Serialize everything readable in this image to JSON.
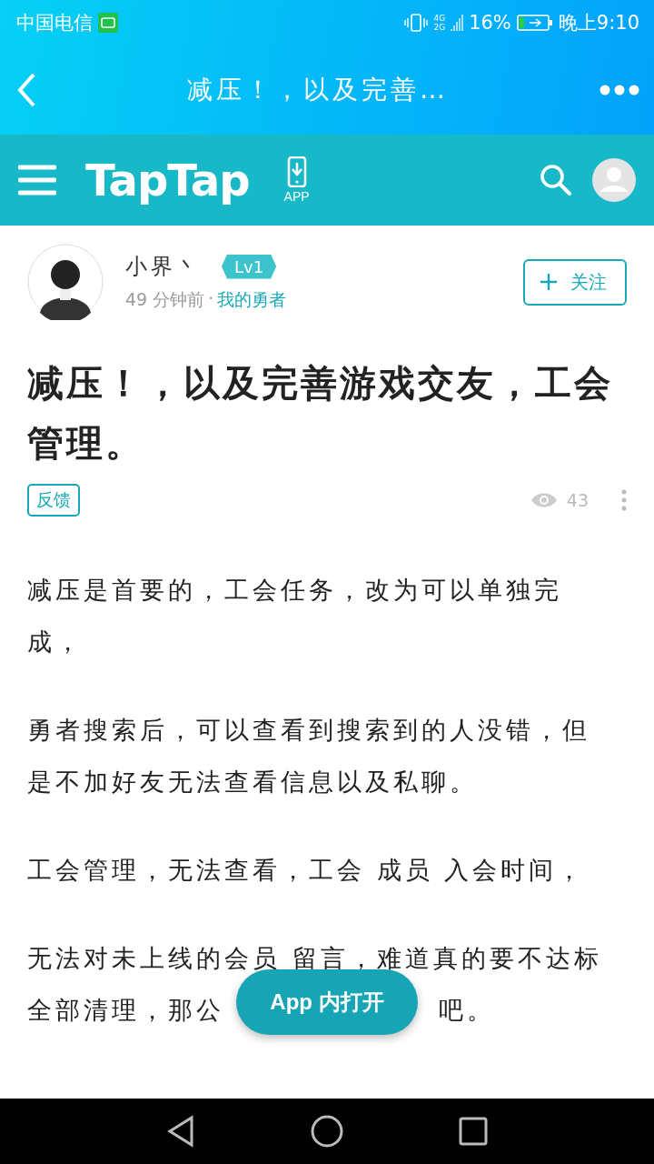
{
  "status_bar": {
    "carrier": "中国电信",
    "network_top": "4G",
    "network_bottom": "2G",
    "battery_percent": "16%",
    "time": "晚上9:10"
  },
  "title_bar": {
    "title": "减压！，以及完善…"
  },
  "site_bar": {
    "logo": "TapTap",
    "app_label": "APP"
  },
  "author": {
    "name": "小界丶",
    "level_badge": "Lv1",
    "time": "49 分钟前",
    "separator": "·",
    "role": "我的勇者",
    "follow_label": "关注"
  },
  "post": {
    "title": "减压！，以及完善游戏交友，工会管理。",
    "tag": "反馈",
    "views": "43",
    "paragraphs": [
      {
        "lines": [
          [
            "减压是首要的，工会任务，改为可以单独完"
          ],
          [
            "成，"
          ]
        ]
      },
      {
        "lines": [
          [
            "勇者搜索后，可以查看到搜索到的人没错，但"
          ],
          [
            "是不加好友无法查看信息以及私聊。"
          ]
        ]
      },
      {
        "lines": [
          [
            "工会管理，无法查看，工会 成员 入会时间，"
          ]
        ]
      },
      {
        "lines": [
          [
            "无法对未上线的会员 留言，难道真的要不达标"
          ],
          [
            "全部清理，那公",
            "吧。"
          ]
        ]
      }
    ]
  },
  "open_in_app": "App 内打开"
}
